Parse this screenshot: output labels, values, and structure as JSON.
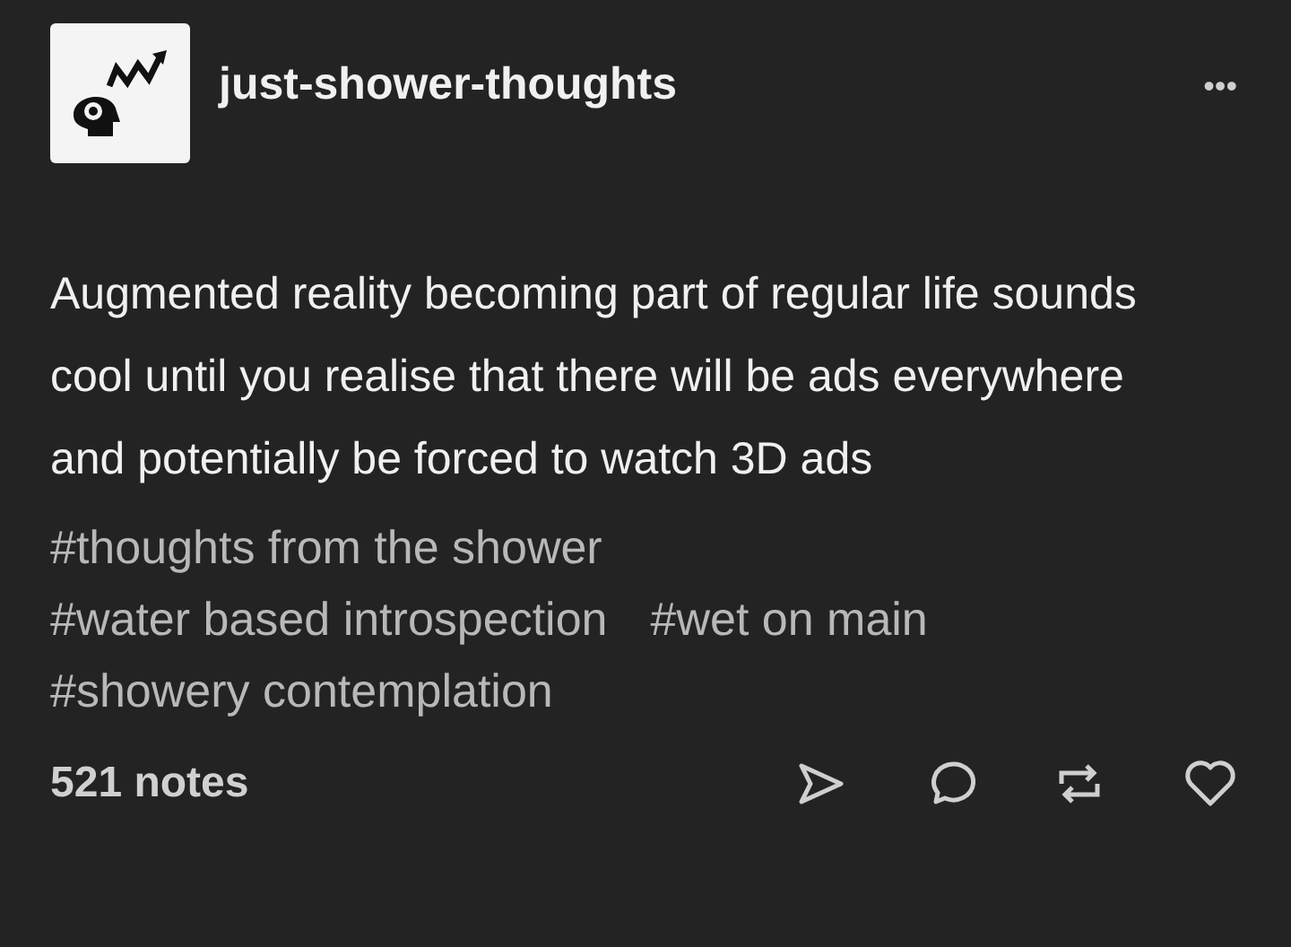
{
  "post": {
    "blog_name": "just-shower-thoughts",
    "menu": "•••",
    "body": "Augmented reality becoming part of regular life sounds cool until you realise that there will be ads everywhere and potentially be forced to watch 3D ads",
    "tags": [
      "#thoughts from the shower",
      "#water based introspection",
      "#wet on main",
      "#showery contemplation"
    ],
    "notes": "521 notes"
  }
}
